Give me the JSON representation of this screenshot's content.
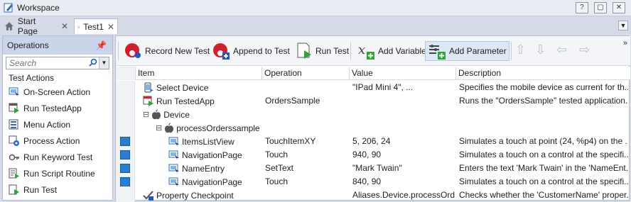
{
  "window": {
    "title": "Workspace",
    "buttons": [
      "?",
      "▢",
      "✕"
    ]
  },
  "tabs": [
    {
      "label": "Start Page",
      "icon": "home-icon",
      "active": false
    },
    {
      "label": "Test1",
      "icon": "keyword-test-icon",
      "active": true
    }
  ],
  "operations_panel": {
    "title": "Operations",
    "search_placeholder": "Search",
    "section": "Test Actions",
    "items": [
      {
        "label": "On-Screen Action",
        "icon": "onscreen-action-icon"
      },
      {
        "label": "Run TestedApp",
        "icon": "run-testedapp-icon"
      },
      {
        "label": "Menu Action",
        "icon": "menu-action-icon"
      },
      {
        "label": "Process Action",
        "icon": "process-action-icon"
      },
      {
        "label": "Run Keyword Test",
        "icon": "run-keyword-test-icon"
      },
      {
        "label": "Run Script Routine",
        "icon": "run-script-routine-icon"
      },
      {
        "label": "Run Test",
        "icon": "run-test-icon"
      }
    ]
  },
  "toolbar": {
    "record": "Record New Test",
    "append": "Append to Test",
    "run": "Run Test",
    "add_variable": "Add Variable",
    "add_parameter": "Add Parameter",
    "more": "»"
  },
  "grid": {
    "columns": [
      "Item",
      "Operation",
      "Value",
      "Description"
    ],
    "rows": [
      {
        "item": "Select Device",
        "operation": "",
        "value": "\"IPad Mini 4\", ...",
        "description": "Specifies the mobile device as current for th...",
        "level": 0,
        "icon": "mobile-device-icon",
        "expander": "",
        "thumb": false
      },
      {
        "item": "Run TestedApp",
        "operation": "OrdersSample",
        "value": "",
        "description": "Runs the \"OrdersSample\" tested application.",
        "level": 0,
        "icon": "run-testedapp-icon",
        "expander": "",
        "thumb": false
      },
      {
        "item": "Device",
        "operation": "",
        "value": "",
        "description": "",
        "level": 0,
        "icon": "apple-icon",
        "expander": "⊟",
        "thumb": false
      },
      {
        "item": "processOrderssample",
        "operation": "",
        "value": "",
        "description": "",
        "level": 1,
        "icon": "apple-icon",
        "expander": "⊟",
        "thumb": false
      },
      {
        "item": "ItemsListView",
        "operation": "TouchItemXY",
        "value": "5, 206, 24",
        "description": "Simulates a touch at point (24, %p4) on the ...",
        "level": 2,
        "icon": "onscreen-action-icon",
        "expander": "",
        "thumb": true
      },
      {
        "item": "NavigationPage",
        "operation": "Touch",
        "value": "940, 90",
        "description": "Simulates a touch on a control at the specifi...",
        "level": 2,
        "icon": "onscreen-action-icon",
        "expander": "",
        "thumb": true
      },
      {
        "item": "NameEntry",
        "operation": "SetText",
        "value": "\"Mark Twain\"",
        "description": "Enters the text 'Mark Twain' in the 'NameEnt...",
        "level": 2,
        "icon": "onscreen-action-icon",
        "expander": "",
        "thumb": true
      },
      {
        "item": "NavigationPage",
        "operation": "Touch",
        "value": "840, 90",
        "description": "Simulates a touch on a control at the specifi...",
        "level": 2,
        "icon": "onscreen-action-icon",
        "expander": "",
        "thumb": true
      },
      {
        "item": "Property Checkpoint",
        "operation": "",
        "value": "Aliases.Device.processOrd...",
        "description": "Checks whether the 'CustomerName' proper...",
        "level": 0,
        "icon": "checkpoint-icon",
        "expander": "",
        "thumb": false
      }
    ]
  },
  "colors": {
    "accent": "#1c57c8",
    "record_red": "#d41f2a",
    "run_green": "#2aa53a",
    "panel_header": "#c9d5ea"
  }
}
